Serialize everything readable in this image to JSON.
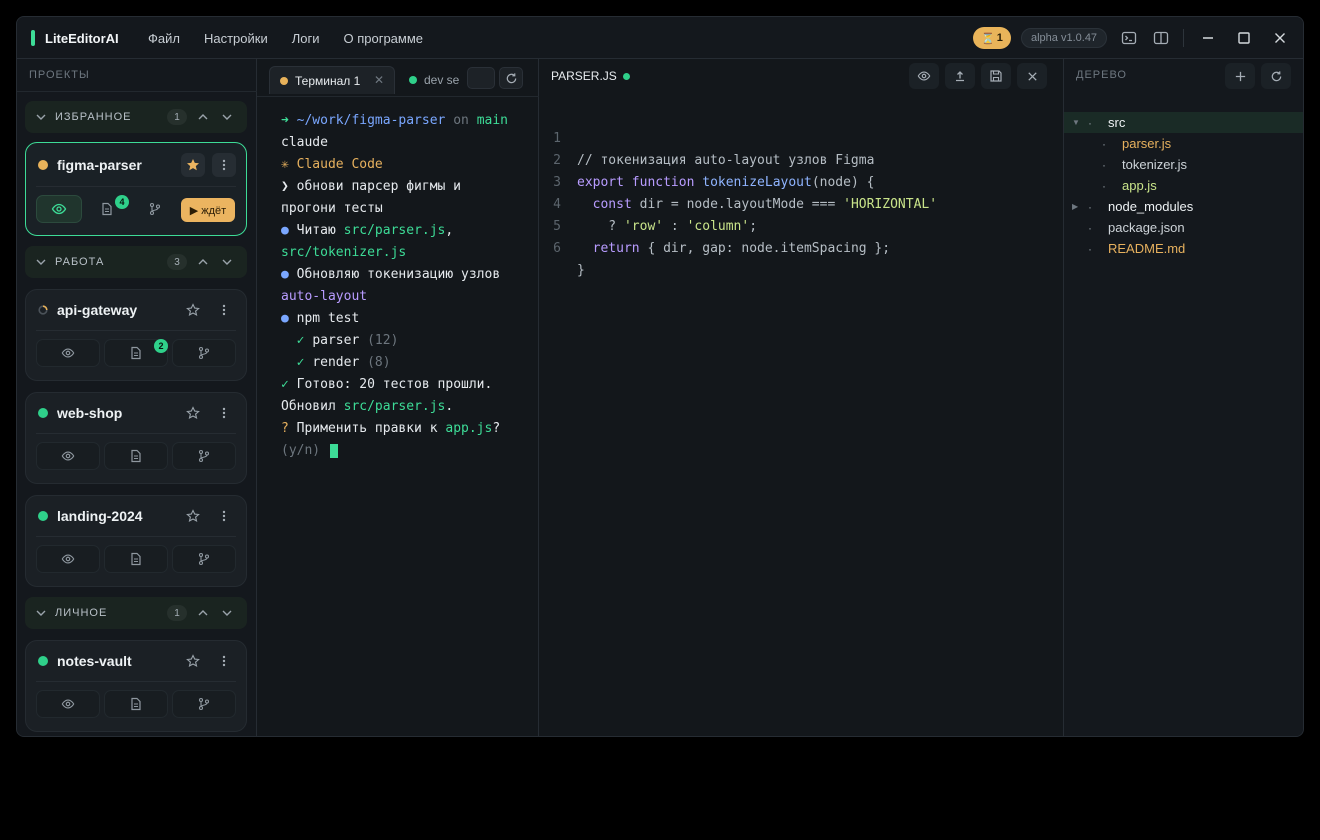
{
  "app": {
    "name": "LiteEditorAI",
    "menu": [
      "Файл",
      "Настройки",
      "Логи",
      "О программе"
    ],
    "timer_badge": "1",
    "version": "alpha v1.0.47",
    "accent": "#3ddc97"
  },
  "sidebar": {
    "heading": "ПРОЕКТЫ",
    "groups": [
      {
        "name": "ИЗБРАННОЕ",
        "count": "1"
      },
      {
        "name": "РАБОТА",
        "count": "3"
      },
      {
        "name": "ЛИЧНОЕ",
        "count": "1"
      }
    ],
    "projects": [
      {
        "name": "figma-parser",
        "status_color": "#e8b25a",
        "starred": true,
        "files_badge": "4",
        "wait_label": "▶ ждёт"
      },
      {
        "name": "api-gateway",
        "status": "loading",
        "files_badge": "2"
      },
      {
        "name": "web-shop",
        "status_color": "#2fd08a"
      },
      {
        "name": "landing-2024",
        "status_color": "#2fd08a"
      },
      {
        "name": "notes-vault",
        "status_color": "#2fd08a"
      }
    ]
  },
  "terminal": {
    "tabs": [
      {
        "label": "Терминал 1",
        "status_color": "#e8b25a"
      },
      {
        "label": "dev se",
        "status_color": "#2fd08a"
      }
    ],
    "lines": {
      "l1_arrow": "➜ ",
      "l1_path": "~/work/figma-parser",
      "l1_on": " on ",
      "l1_branch": "main",
      "l2": "claude",
      "l3": "✳ Claude Code",
      "l4": "❯ обнови парсер фигмы и",
      "l5": "прогони тесты",
      "l6_bullet": "● ",
      "l6_text": "Читаю ",
      "l6_file": "src/parser.js",
      "l6_comma": ",",
      "l7": "src/tokenizer.js",
      "l8_bullet": "● ",
      "l8_text": "Обновляю токенизацию узлов",
      "l9": "auto-layout",
      "l10_bullet": "● ",
      "l10_text": "npm test",
      "l11_check": "  ✓ ",
      "l11_name": "parser",
      "l11_count": " (12)",
      "l12_check": "  ✓ ",
      "l12_name": "render",
      "l12_count": " (8)",
      "l13_check": "✓ ",
      "l13_text": "Готово: 20 тестов прошли.",
      "l14_text": "Обновил ",
      "l14_file": "src/parser.js",
      "l14_dot": ".",
      "l15_q": "? ",
      "l15_text": "Применить правки к ",
      "l15_file": "app.js",
      "l15_end": "?",
      "l16": "(y/n) "
    }
  },
  "editor": {
    "title": "PARSER.JS",
    "lines": [
      {
        "num": "1"
      },
      {
        "num": "2"
      },
      {
        "num": "3"
      },
      {
        "num": "4"
      },
      {
        "num": "5"
      },
      {
        "num": "6"
      }
    ],
    "code": {
      "l1": "// токенизация auto-layout узлов Figma",
      "l2_export": "export",
      "l2_function": "function",
      "l2_name": "tokenizeLayout",
      "l2_rest": "(node) {",
      "l3_const": "const",
      "l3_mid": " dir = node.layoutMode === ",
      "l3_str": "'HORIZONTAL'",
      "l4_q": "    ? ",
      "l4_row": "'row'",
      "l4_colon": " : ",
      "l4_col": "'column'",
      "l4_end": ";",
      "l5_return": "return",
      "l5_rest": " { dir, gap: node.itemSpacing };",
      "l6": "}"
    }
  },
  "tree": {
    "heading": "ДЕРЕВО",
    "items": [
      {
        "name": "src",
        "color": "#eef2f4"
      },
      {
        "name": "parser.js",
        "color": "#e7b15e"
      },
      {
        "name": "tokenizer.js",
        "color": "#cdd3d8"
      },
      {
        "name": "app.js",
        "color": "#c9e48a"
      },
      {
        "name": "node_modules",
        "color": "#eef2f4"
      },
      {
        "name": "package.json",
        "color": "#cdd3d8"
      },
      {
        "name": "README.md",
        "color": "#e7b15e"
      }
    ]
  }
}
